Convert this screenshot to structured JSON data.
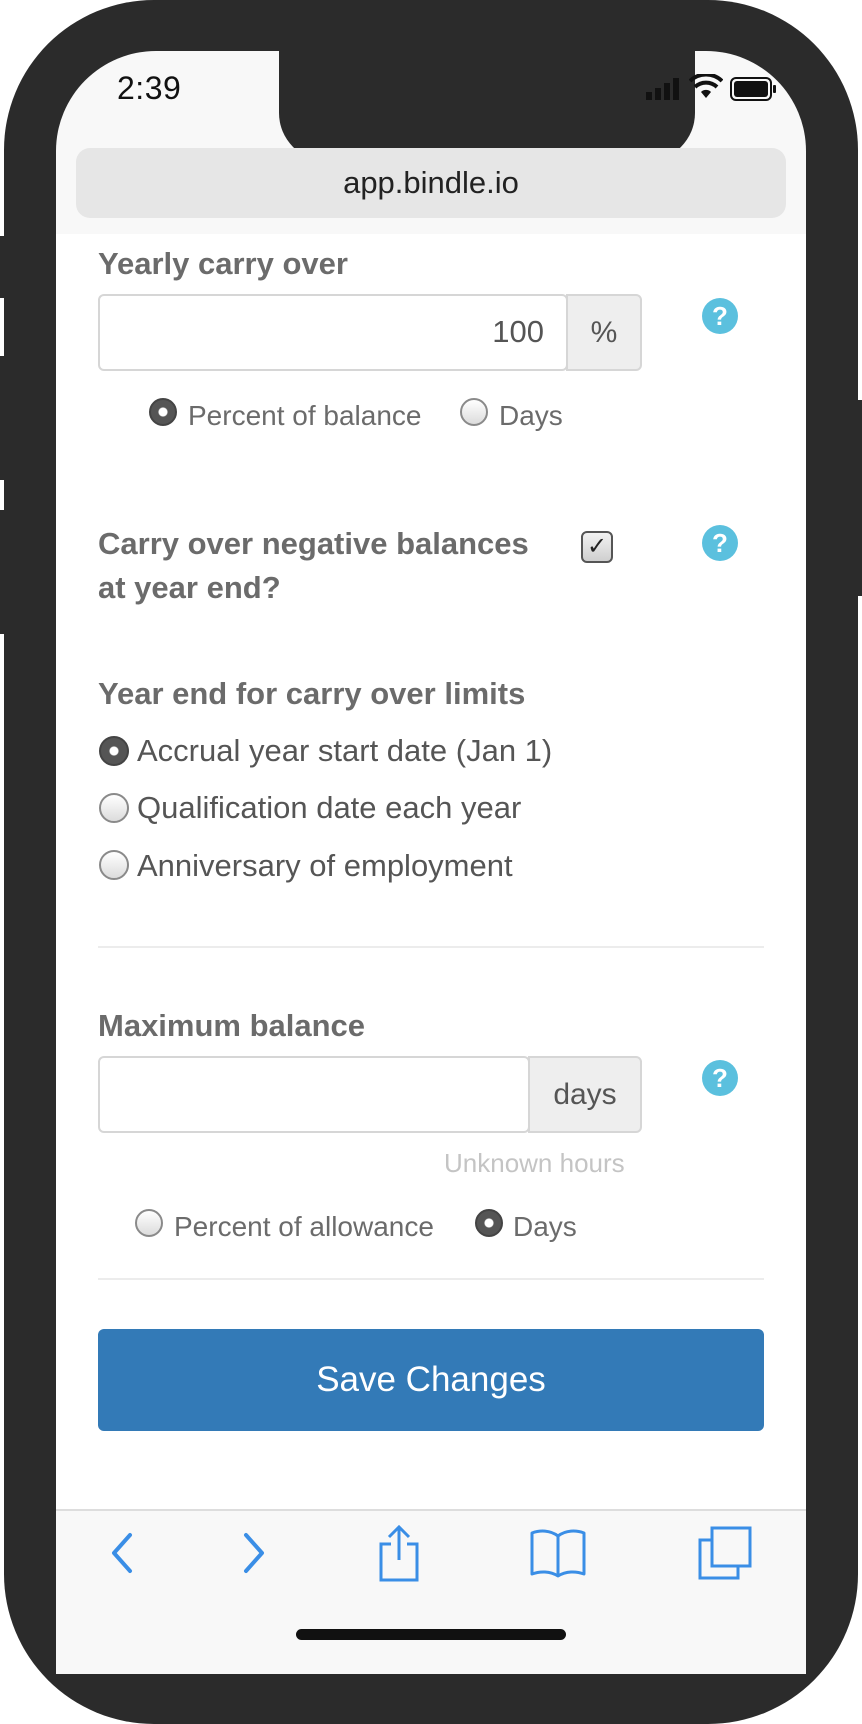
{
  "status_bar": {
    "time": "2:39"
  },
  "browser": {
    "url": "app.bindle.io"
  },
  "yearly_carry_over": {
    "label": "Yearly carry over",
    "value": "100",
    "unit": "%",
    "options": [
      "Percent of balance",
      "Days"
    ],
    "selected": "Percent of balance"
  },
  "negative_balances": {
    "label_line1": "Carry over negative balances",
    "label_line2": "at year end?",
    "checked": true
  },
  "year_end": {
    "label": "Year end for carry over limits",
    "options": [
      "Accrual year start date (Jan 1)",
      "Qualification date each year",
      "Anniversary of employment"
    ],
    "selected": "Accrual year start date (Jan 1)"
  },
  "maximum_balance": {
    "label": "Maximum balance",
    "value": "",
    "unit": "days",
    "hint": "Unknown hours",
    "options": [
      "Percent of allowance",
      "Days"
    ],
    "selected": "Days"
  },
  "save_button": "Save Changes",
  "help_glyph": "?",
  "check_glyph": "✓",
  "toolbar_icons": [
    "back-icon",
    "forward-icon",
    "share-icon",
    "bookmarks-icon",
    "tabs-icon"
  ],
  "colors": {
    "primary": "#337ab7",
    "help": "#5bc0de",
    "ios_blue": "#3a8ee6"
  }
}
